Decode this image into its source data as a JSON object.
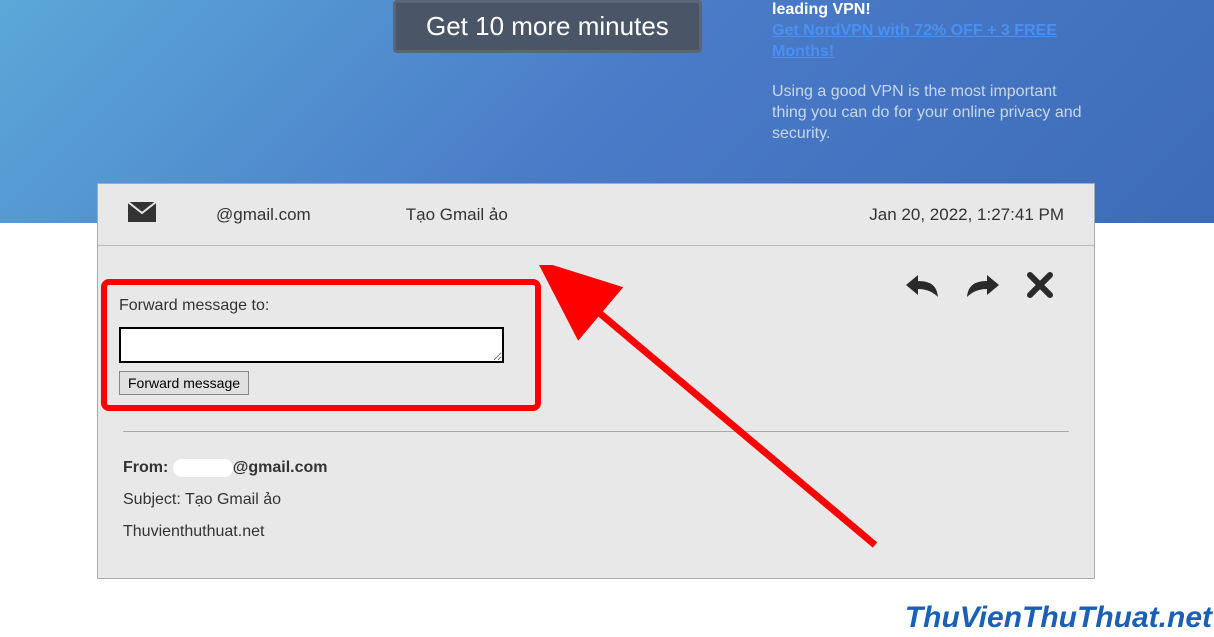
{
  "top": {
    "button_label": "Get 10 more minutes",
    "vpn": {
      "leading": "leading VPN!",
      "offer": "Get NordVPN with 72% OFF + 3 FREE Months!",
      "info": "Using a good VPN is the most important thing you can do for your online privacy and security."
    }
  },
  "email": {
    "header": {
      "from_fragment": "@gmail.com",
      "subject": "Tạo Gmail ảo",
      "date": "Jan 20, 2022, 1:27:41 PM"
    },
    "forward": {
      "label": "Forward message to:",
      "button_label": "Forward message"
    },
    "body": {
      "from_label": "From:",
      "from_domain": "@gmail.com",
      "subject_line": "Subject: Tạo Gmail ảo",
      "content": "Thuvienthuthuat.net"
    }
  },
  "watermark": "ThuVienThuThuat.net"
}
